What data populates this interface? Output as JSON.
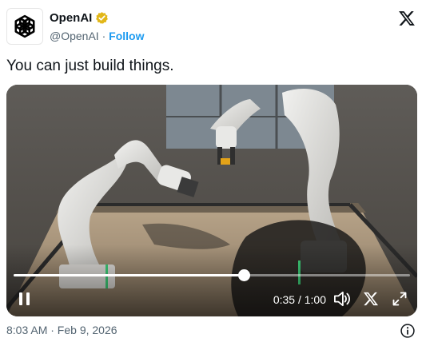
{
  "author": {
    "name": "OpenAI",
    "handle": "@OpenAI",
    "separator": "·",
    "follow_label": "Follow"
  },
  "tweet": {
    "text": "You can just build things."
  },
  "video": {
    "current_time": "0:35",
    "time_separator": "/",
    "duration": "1:00",
    "progress": 0.58,
    "state": "playing"
  },
  "timestamp": "8:03 AM · Feb 9, 2026",
  "icons": {
    "platform": "x-logo-icon",
    "verified": "verified-badge-icon",
    "pause": "pause-icon",
    "volume": "volume-icon",
    "fullscreen": "fullscreen-icon",
    "info": "info-icon"
  },
  "colors": {
    "accent": "#1d9bf0",
    "verified": "#e2b719",
    "text": "#0f1419",
    "muted": "#536471"
  }
}
